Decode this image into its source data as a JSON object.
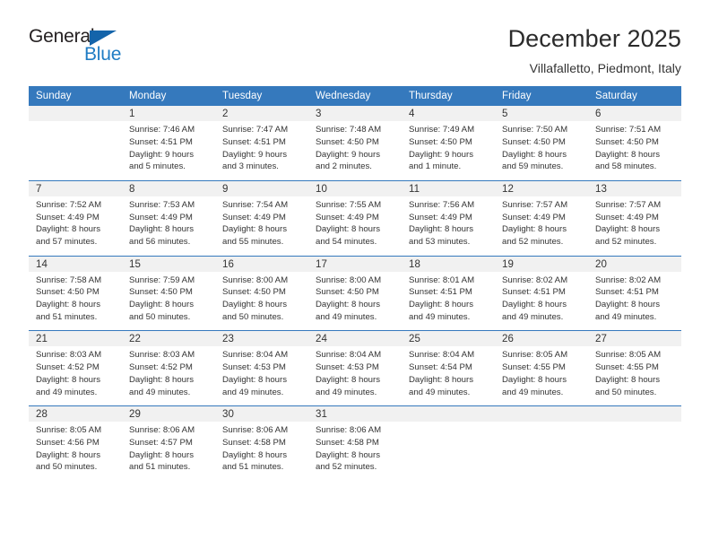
{
  "brand": {
    "name_top": "General",
    "name_bottom": "Blue",
    "logo_icon": "triangle-icon",
    "accent_color": "#1f7cc4",
    "triangle_color": "#1464aa"
  },
  "header": {
    "title": "December 2025",
    "subtitle": "Villafalletto, Piedmont, Italy"
  },
  "calendar": {
    "header_background": "#3579bd",
    "daynum_background": "#f1f1f1",
    "weekdays": [
      "Sunday",
      "Monday",
      "Tuesday",
      "Wednesday",
      "Thursday",
      "Friday",
      "Saturday"
    ],
    "weeks": [
      [
        {
          "day": "",
          "lines": []
        },
        {
          "day": "1",
          "lines": [
            "Sunrise: 7:46 AM",
            "Sunset: 4:51 PM",
            "Daylight: 9 hours",
            "and 5 minutes."
          ]
        },
        {
          "day": "2",
          "lines": [
            "Sunrise: 7:47 AM",
            "Sunset: 4:51 PM",
            "Daylight: 9 hours",
            "and 3 minutes."
          ]
        },
        {
          "day": "3",
          "lines": [
            "Sunrise: 7:48 AM",
            "Sunset: 4:50 PM",
            "Daylight: 9 hours",
            "and 2 minutes."
          ]
        },
        {
          "day": "4",
          "lines": [
            "Sunrise: 7:49 AM",
            "Sunset: 4:50 PM",
            "Daylight: 9 hours",
            "and 1 minute."
          ]
        },
        {
          "day": "5",
          "lines": [
            "Sunrise: 7:50 AM",
            "Sunset: 4:50 PM",
            "Daylight: 8 hours",
            "and 59 minutes."
          ]
        },
        {
          "day": "6",
          "lines": [
            "Sunrise: 7:51 AM",
            "Sunset: 4:50 PM",
            "Daylight: 8 hours",
            "and 58 minutes."
          ]
        }
      ],
      [
        {
          "day": "7",
          "lines": [
            "Sunrise: 7:52 AM",
            "Sunset: 4:49 PM",
            "Daylight: 8 hours",
            "and 57 minutes."
          ]
        },
        {
          "day": "8",
          "lines": [
            "Sunrise: 7:53 AM",
            "Sunset: 4:49 PM",
            "Daylight: 8 hours",
            "and 56 minutes."
          ]
        },
        {
          "day": "9",
          "lines": [
            "Sunrise: 7:54 AM",
            "Sunset: 4:49 PM",
            "Daylight: 8 hours",
            "and 55 minutes."
          ]
        },
        {
          "day": "10",
          "lines": [
            "Sunrise: 7:55 AM",
            "Sunset: 4:49 PM",
            "Daylight: 8 hours",
            "and 54 minutes."
          ]
        },
        {
          "day": "11",
          "lines": [
            "Sunrise: 7:56 AM",
            "Sunset: 4:49 PM",
            "Daylight: 8 hours",
            "and 53 minutes."
          ]
        },
        {
          "day": "12",
          "lines": [
            "Sunrise: 7:57 AM",
            "Sunset: 4:49 PM",
            "Daylight: 8 hours",
            "and 52 minutes."
          ]
        },
        {
          "day": "13",
          "lines": [
            "Sunrise: 7:57 AM",
            "Sunset: 4:49 PM",
            "Daylight: 8 hours",
            "and 52 minutes."
          ]
        }
      ],
      [
        {
          "day": "14",
          "lines": [
            "Sunrise: 7:58 AM",
            "Sunset: 4:50 PM",
            "Daylight: 8 hours",
            "and 51 minutes."
          ]
        },
        {
          "day": "15",
          "lines": [
            "Sunrise: 7:59 AM",
            "Sunset: 4:50 PM",
            "Daylight: 8 hours",
            "and 50 minutes."
          ]
        },
        {
          "day": "16",
          "lines": [
            "Sunrise: 8:00 AM",
            "Sunset: 4:50 PM",
            "Daylight: 8 hours",
            "and 50 minutes."
          ]
        },
        {
          "day": "17",
          "lines": [
            "Sunrise: 8:00 AM",
            "Sunset: 4:50 PM",
            "Daylight: 8 hours",
            "and 49 minutes."
          ]
        },
        {
          "day": "18",
          "lines": [
            "Sunrise: 8:01 AM",
            "Sunset: 4:51 PM",
            "Daylight: 8 hours",
            "and 49 minutes."
          ]
        },
        {
          "day": "19",
          "lines": [
            "Sunrise: 8:02 AM",
            "Sunset: 4:51 PM",
            "Daylight: 8 hours",
            "and 49 minutes."
          ]
        },
        {
          "day": "20",
          "lines": [
            "Sunrise: 8:02 AM",
            "Sunset: 4:51 PM",
            "Daylight: 8 hours",
            "and 49 minutes."
          ]
        }
      ],
      [
        {
          "day": "21",
          "lines": [
            "Sunrise: 8:03 AM",
            "Sunset: 4:52 PM",
            "Daylight: 8 hours",
            "and 49 minutes."
          ]
        },
        {
          "day": "22",
          "lines": [
            "Sunrise: 8:03 AM",
            "Sunset: 4:52 PM",
            "Daylight: 8 hours",
            "and 49 minutes."
          ]
        },
        {
          "day": "23",
          "lines": [
            "Sunrise: 8:04 AM",
            "Sunset: 4:53 PM",
            "Daylight: 8 hours",
            "and 49 minutes."
          ]
        },
        {
          "day": "24",
          "lines": [
            "Sunrise: 8:04 AM",
            "Sunset: 4:53 PM",
            "Daylight: 8 hours",
            "and 49 minutes."
          ]
        },
        {
          "day": "25",
          "lines": [
            "Sunrise: 8:04 AM",
            "Sunset: 4:54 PM",
            "Daylight: 8 hours",
            "and 49 minutes."
          ]
        },
        {
          "day": "26",
          "lines": [
            "Sunrise: 8:05 AM",
            "Sunset: 4:55 PM",
            "Daylight: 8 hours",
            "and 49 minutes."
          ]
        },
        {
          "day": "27",
          "lines": [
            "Sunrise: 8:05 AM",
            "Sunset: 4:55 PM",
            "Daylight: 8 hours",
            "and 50 minutes."
          ]
        }
      ],
      [
        {
          "day": "28",
          "lines": [
            "Sunrise: 8:05 AM",
            "Sunset: 4:56 PM",
            "Daylight: 8 hours",
            "and 50 minutes."
          ]
        },
        {
          "day": "29",
          "lines": [
            "Sunrise: 8:06 AM",
            "Sunset: 4:57 PM",
            "Daylight: 8 hours",
            "and 51 minutes."
          ]
        },
        {
          "day": "30",
          "lines": [
            "Sunrise: 8:06 AM",
            "Sunset: 4:58 PM",
            "Daylight: 8 hours",
            "and 51 minutes."
          ]
        },
        {
          "day": "31",
          "lines": [
            "Sunrise: 8:06 AM",
            "Sunset: 4:58 PM",
            "Daylight: 8 hours",
            "and 52 minutes."
          ]
        },
        {
          "day": "",
          "lines": []
        },
        {
          "day": "",
          "lines": []
        },
        {
          "day": "",
          "lines": []
        }
      ]
    ]
  }
}
